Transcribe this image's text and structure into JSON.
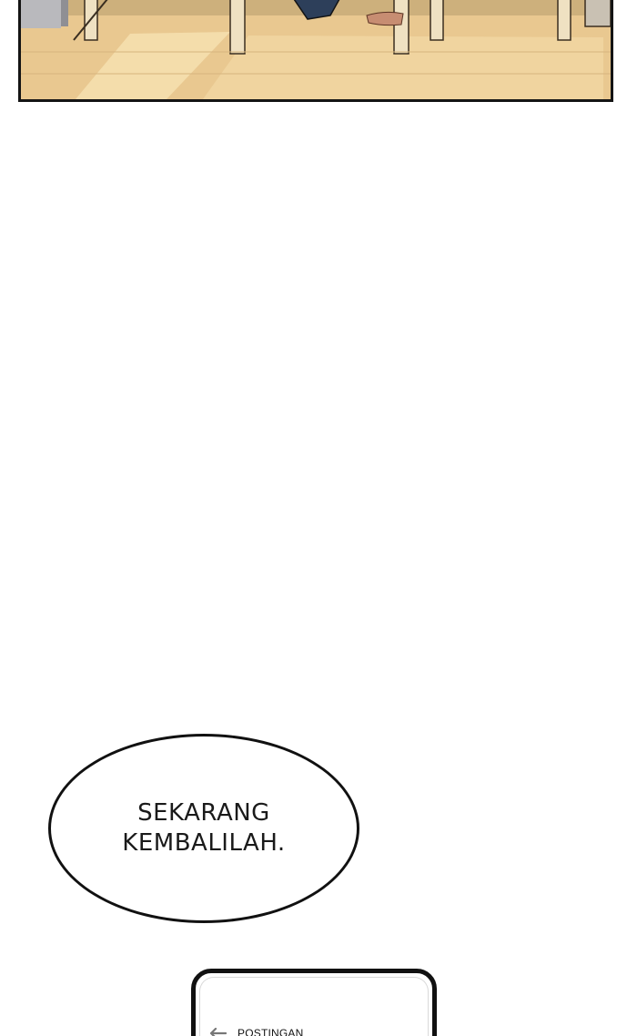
{
  "speech_bubble": {
    "line1": "SEKARANG",
    "line2": "KEMBALILAH."
  },
  "phone_screen": {
    "header_title": "POSTINGAN",
    "back_icon": "arrow-left-icon"
  },
  "colors": {
    "floor": "#e9c890",
    "floor_light": "#f4dba8",
    "outline": "#141414"
  }
}
